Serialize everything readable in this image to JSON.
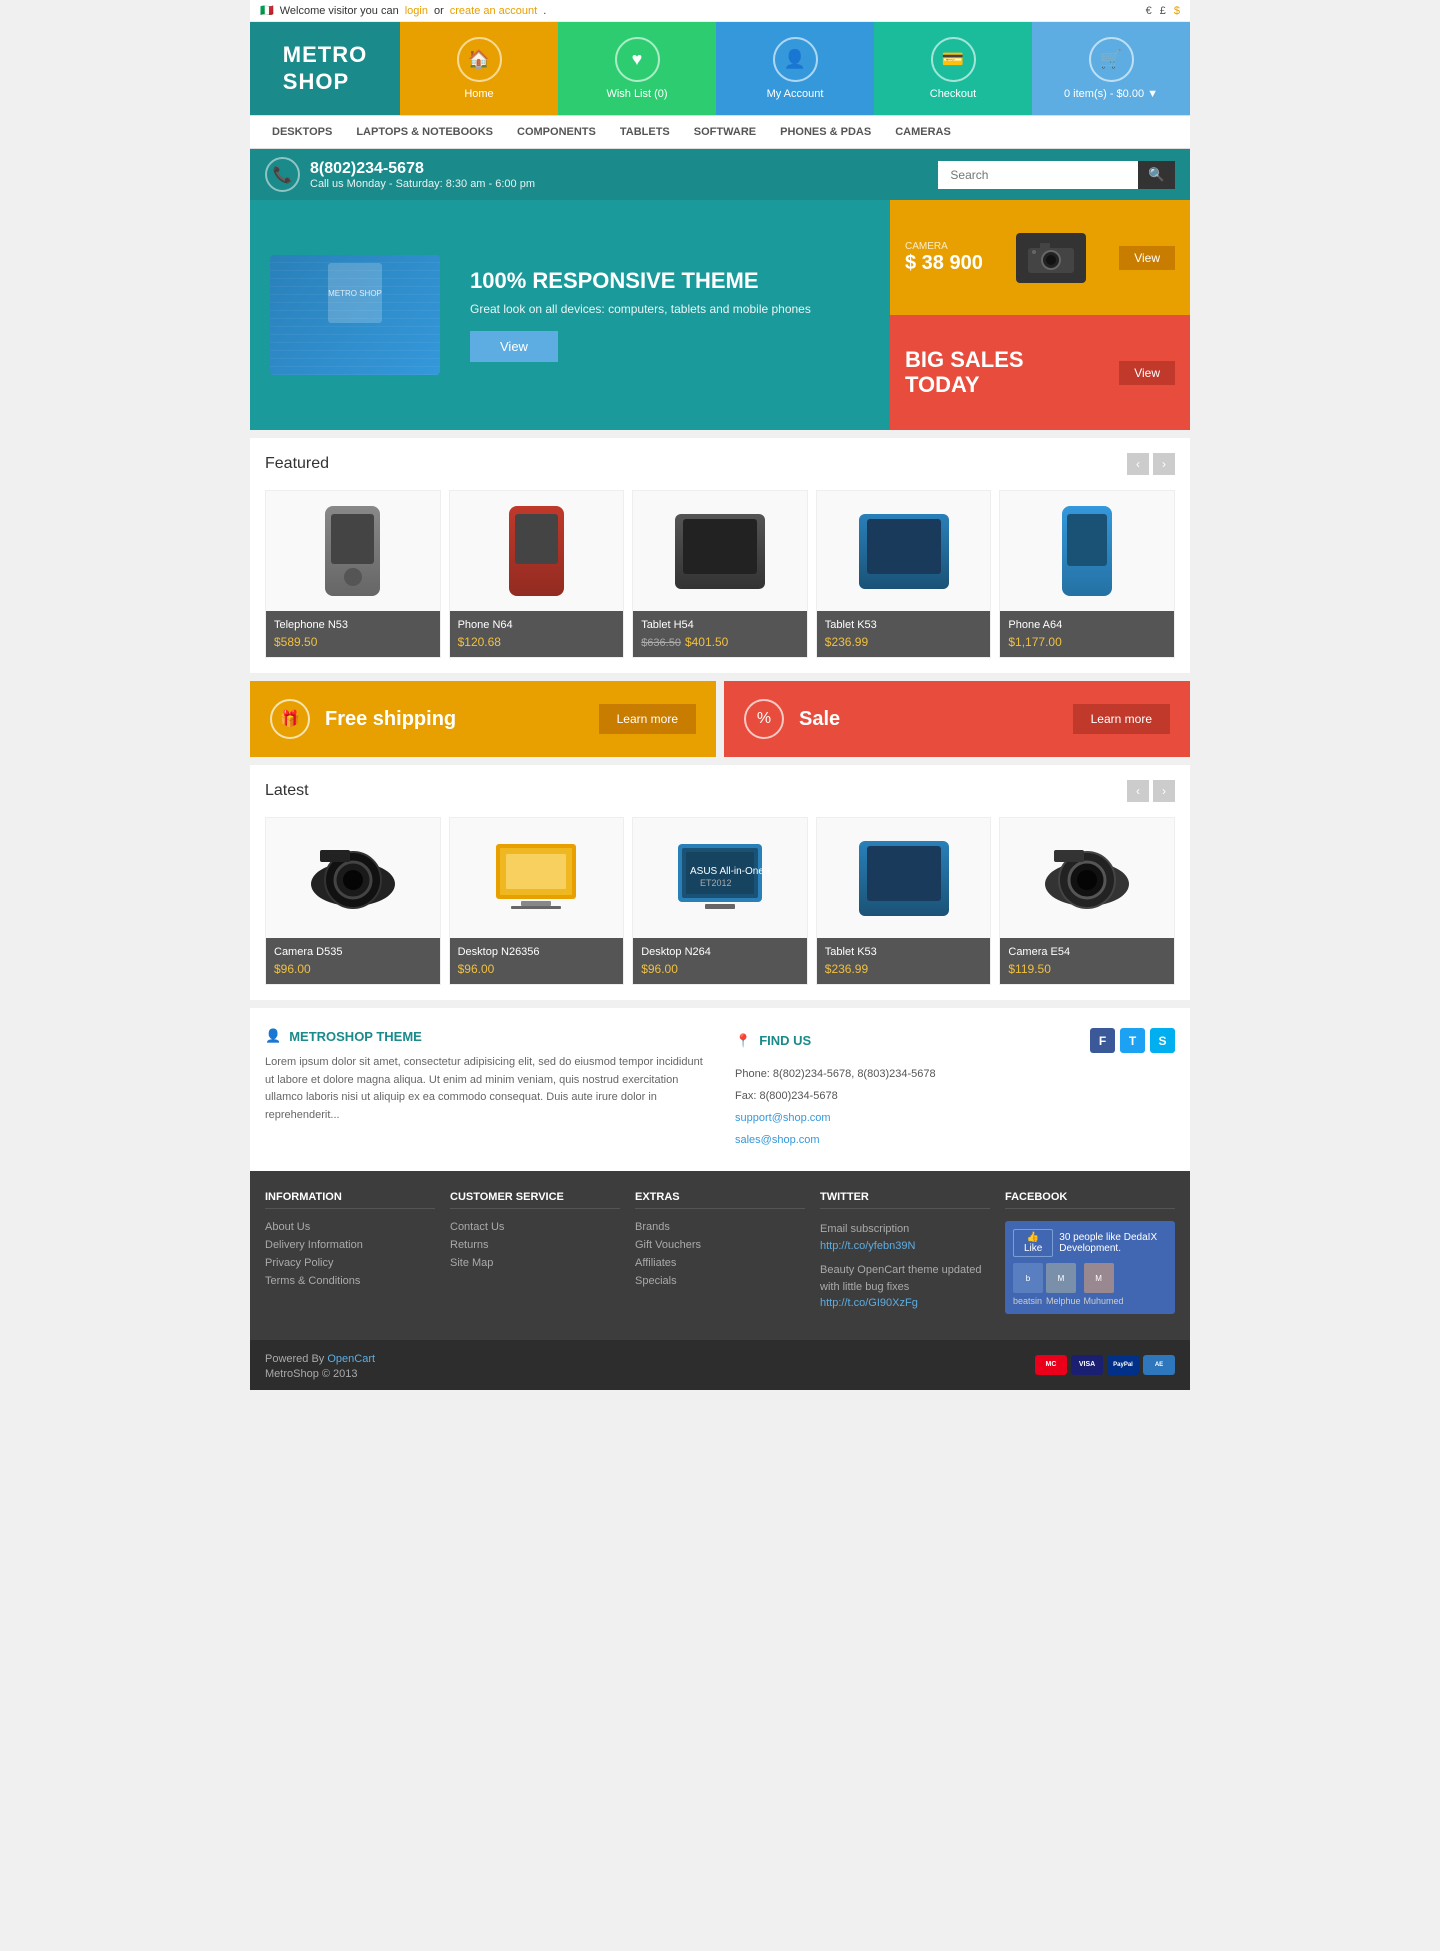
{
  "topbar": {
    "welcome": "Welcome visitor you can",
    "login": "login",
    "or": "or",
    "create_account": "create an account",
    "currencies": [
      "€",
      "£",
      "$"
    ]
  },
  "header": {
    "logo_line1": "METRO",
    "logo_line2": "SHOP",
    "nav": [
      {
        "label": "Home",
        "icon": "🏠"
      },
      {
        "label": "Wish List (0)",
        "icon": "♥"
      },
      {
        "label": "My Account",
        "icon": "👤"
      },
      {
        "label": "Checkout",
        "icon": "💳"
      },
      {
        "label": "0 item(s) - $0.00",
        "icon": "🛒"
      }
    ]
  },
  "mainnav": {
    "items": [
      "Desktops",
      "Laptops & Notebooks",
      "Components",
      "Tablets",
      "Software",
      "Phones & PDAs",
      "Cameras"
    ]
  },
  "contactbar": {
    "phone": "8(802)234-5678",
    "hours": "Call us Monday - Saturday: 8:30 am - 6:00 pm",
    "search_placeholder": "Search"
  },
  "hero": {
    "main_title": "100% RESPONSIVE THEME",
    "main_subtitle": "Great look on all devices: computers, tablets and mobile phones",
    "main_btn": "View",
    "camera_label": "CAMERA",
    "camera_price": "$ 38 900",
    "camera_btn": "View",
    "sale_line1": "BIG SALES",
    "sale_line2": "TODAY",
    "sale_btn": "View"
  },
  "featured": {
    "title": "Featured",
    "products": [
      {
        "name": "Telephone N53",
        "price": "$589.50",
        "old_price": "",
        "shape": "phone-n53",
        "type": "phone"
      },
      {
        "name": "Phone N64",
        "price": "$120.68",
        "old_price": "",
        "shape": "phone-n64",
        "type": "phone"
      },
      {
        "name": "Tablet H54",
        "price": "$401.50",
        "old_price": "$636.50",
        "shape": "tablet-h54",
        "type": "tablet"
      },
      {
        "name": "Tablet K53",
        "price": "$236.99",
        "old_price": "",
        "shape": "tablet-k53",
        "type": "tablet"
      },
      {
        "name": "Phone A64",
        "price": "$1,177.00",
        "old_price": "",
        "shape": "phone-a64",
        "type": "phone"
      }
    ]
  },
  "promo": {
    "free_shipping_label": "Free shipping",
    "free_shipping_btn": "Learn more",
    "sale_label": "Sale",
    "sale_btn": "Learn more"
  },
  "latest": {
    "title": "Latest",
    "products": [
      {
        "name": "Camera D535",
        "price": "$96.00",
        "old_price": "",
        "shape": "camera-d535",
        "type": "camera"
      },
      {
        "name": "Desktop N26356",
        "price": "$96.00",
        "old_price": "",
        "shape": "desktop-n26",
        "type": "desktop"
      },
      {
        "name": "Desktop N264",
        "price": "$96.00",
        "old_price": "",
        "shape": "desktop-n264",
        "type": "desktop"
      },
      {
        "name": "Tablet K53",
        "price": "$236.99",
        "old_price": "",
        "shape": "tablet-k53",
        "type": "tablet"
      },
      {
        "name": "Camera E54",
        "price": "$119.50",
        "old_price": "",
        "shape": "camera-e54",
        "type": "camera"
      }
    ]
  },
  "footer_about": {
    "title": "METROSHOP THEME",
    "text": "Lorem ipsum dolor sit amet, consectetur adipisicing elit, sed do eiusmod tempor incididunt ut labore et dolore magna aliqua. Ut enim ad minim veniam, quis nostrud exercitation ullamco laboris nisi ut aliquip ex ea commodo consequat. Duis aute irure dolor in reprehenderit..."
  },
  "footer_findus": {
    "title": "FIND US",
    "phone": "Phone: 8(802)234-5678, 8(803)234-5678",
    "fax": "Fax: 8(800)234-5678",
    "email1": "support@shop.com",
    "email2": "sales@shop.com"
  },
  "footer_links": {
    "information": {
      "title": "INFORMATION",
      "links": [
        "About Us",
        "Delivery Information",
        "Privacy Policy",
        "Terms & Conditions"
      ]
    },
    "customer_service": {
      "title": "CUSTOMER SERVICE",
      "links": [
        "Contact Us",
        "Returns",
        "Site Map"
      ]
    },
    "extras": {
      "title": "EXTRAS",
      "links": [
        "Brands",
        "Gift Vouchers",
        "Affiliates",
        "Specials"
      ]
    },
    "twitter": {
      "title": "TWITTER",
      "subscription": "Email subscription",
      "tweet1_link": "http://t.co/yfebn39N",
      "tweet1_text": "Beauty OpenCart theme updated with little bug fixes",
      "tweet2_link": "http://t.co/GI90XzFg"
    },
    "facebook": {
      "title": "FACEBOOK",
      "like_text": "30 people like DedaIX Development.",
      "users": [
        "beatsin",
        "Melphue",
        "Muhumed"
      ]
    }
  },
  "bottombar": {
    "powered_by": "Powered By",
    "opencart": "OpenCart",
    "copyright": "MetroShop © 2013",
    "payments": [
      "MC",
      "VISA",
      "PayPal",
      "AE"
    ]
  }
}
